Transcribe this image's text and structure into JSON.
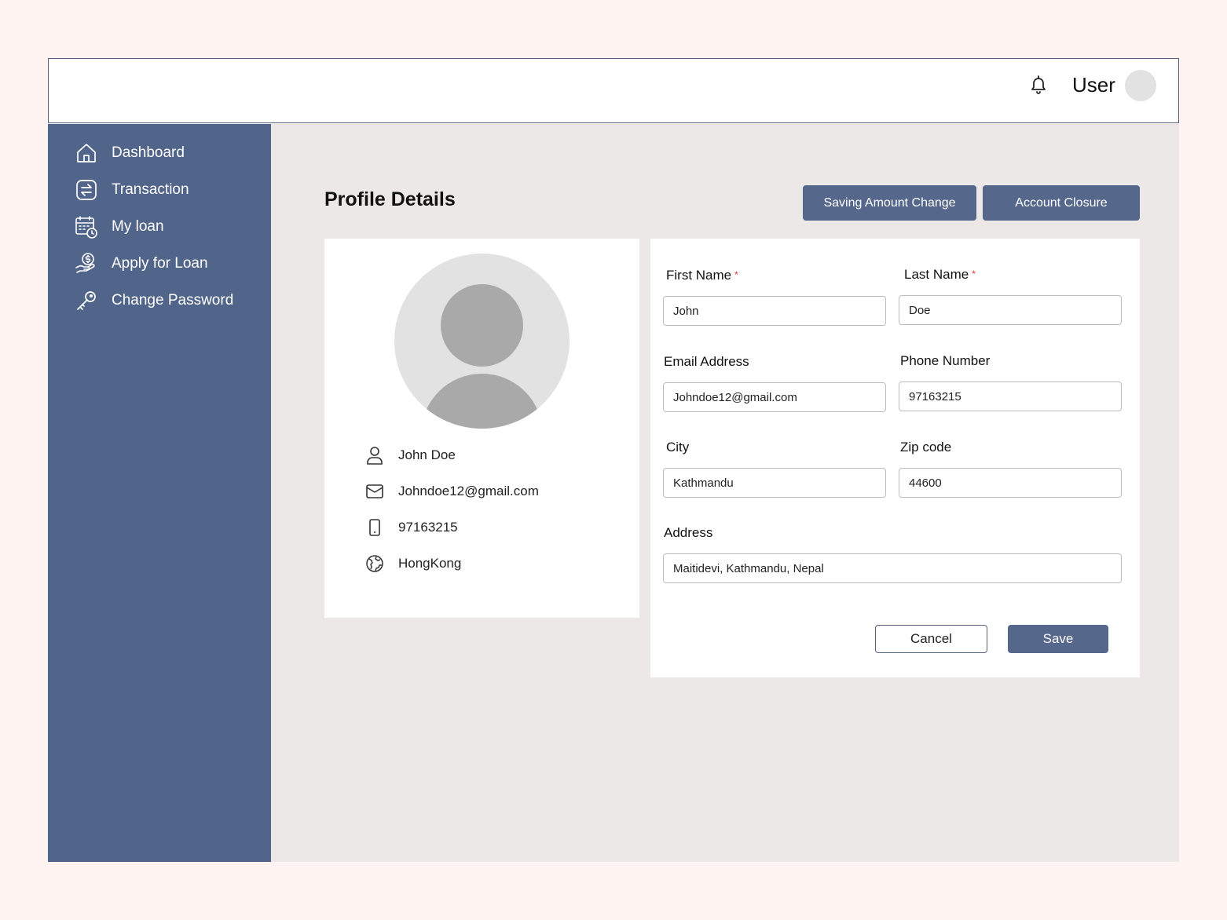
{
  "header": {
    "user_label": "User",
    "icons": {
      "notifications": "bell-icon",
      "avatar": "user-avatar"
    }
  },
  "sidebar": {
    "background": "#51658a",
    "items": [
      {
        "label": "Dashboard",
        "icon": "home-icon"
      },
      {
        "label": "Transaction",
        "icon": "transaction-icon"
      },
      {
        "label": "My loan",
        "icon": "calendar-clock-icon"
      },
      {
        "label": "Apply for Loan",
        "icon": "hand-coin-icon"
      },
      {
        "label": "Change Password",
        "icon": "key-icon"
      }
    ]
  },
  "main": {
    "title": "Profile Details",
    "actions": {
      "saving_amount_change": "Saving Amount Change",
      "account_closure": "Account Closure"
    }
  },
  "profile_card": {
    "name": "John Doe",
    "email": "Johndoe12@gmail.com",
    "phone": "97163215",
    "country": "HongKong"
  },
  "form": {
    "first_name": {
      "label": "First Name",
      "required_mark": "*",
      "value": "John"
    },
    "last_name": {
      "label": "Last Name",
      "required_mark": "*",
      "value": "Doe"
    },
    "email": {
      "label": "Email Address",
      "value": "Johndoe12@gmail.com"
    },
    "phone": {
      "label": "Phone Number",
      "value": "97163215"
    },
    "city": {
      "label": "City",
      "value": "Kathmandu"
    },
    "zip": {
      "label": "Zip code",
      "value": "44600"
    },
    "address": {
      "label": "Address",
      "value": "Maitidevi, Kathmandu, Nepal"
    },
    "cancel_label": "Cancel",
    "save_label": "Save"
  },
  "colors": {
    "accent": "#55678b",
    "page_bg": "#fff4f2",
    "content_bg": "#ece8e7",
    "required": "#e03030"
  }
}
